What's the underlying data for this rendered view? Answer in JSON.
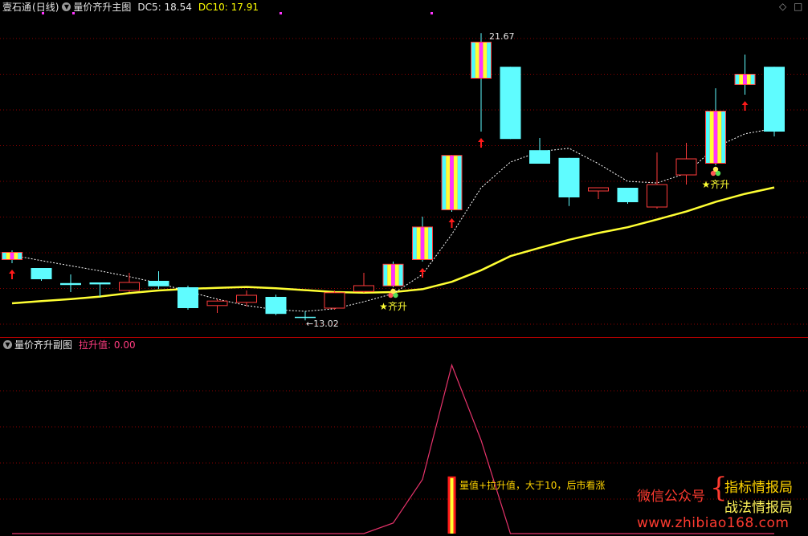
{
  "main_header": {
    "stock": "壹石通",
    "period": "(日线)",
    "title": "量价齐升主图",
    "dc5_label": "DC5: 18.54",
    "dc10_label": "DC10: 17.91"
  },
  "sub_header": {
    "title": "量价齐升副图",
    "value_label": "拉升值: 0.00"
  },
  "corner_icons": [
    "diamond-icon",
    "expand-icon"
  ],
  "colors": {
    "up_candle": "#ff3b3b",
    "down_candle": "#5ffcff",
    "ma_line": "#ffff33",
    "dashed_line": "#ffffff",
    "sub_line": "#e6336b",
    "grid": "#8b0000",
    "arrow": "#ff1a1a"
  },
  "annotations": {
    "high_label": "21.67",
    "low_label": "13.02",
    "qisheng_1": "★齐升",
    "qisheng_2": "★齐升"
  },
  "sub_note": "量值+拉升值，大于10，后市看涨",
  "watermark": {
    "wechat": "微信公众号",
    "name1": "指标情报局",
    "name2": "战法情报局",
    "url": "www.zhibiao168.com"
  },
  "chart_data": [
    {
      "type": "candlestick",
      "title": "量价齐升主图",
      "ylim": [
        12.2,
        22.2
      ],
      "candles": [
        {
          "o": 14.85,
          "c": 14.6,
          "h": 14.9,
          "l": 14.5,
          "color": "rainbow",
          "arrow": true
        },
        {
          "o": 14.35,
          "c": 14.0,
          "h": 14.35,
          "l": 13.95,
          "color": "cyan"
        },
        {
          "o": 13.88,
          "c": 13.82,
          "h": 14.15,
          "l": 13.6,
          "color": "cyan"
        },
        {
          "o": 13.9,
          "c": 13.84,
          "h": 13.9,
          "l": 13.45,
          "color": "cyan"
        },
        {
          "o": 13.65,
          "c": 13.9,
          "h": 14.2,
          "l": 13.6,
          "color": "red"
        },
        {
          "o": 13.95,
          "c": 13.78,
          "h": 14.25,
          "l": 13.7,
          "color": "cyan"
        },
        {
          "o": 13.75,
          "c": 13.1,
          "h": 13.8,
          "l": 13.05,
          "color": "cyan"
        },
        {
          "o": 13.18,
          "c": 13.32,
          "h": 13.38,
          "l": 12.95,
          "color": "red"
        },
        {
          "o": 13.28,
          "c": 13.5,
          "h": 13.65,
          "l": 13.15,
          "color": "red"
        },
        {
          "o": 13.45,
          "c": 12.92,
          "h": 13.52,
          "l": 12.88,
          "color": "cyan"
        },
        {
          "o": 12.83,
          "c": 12.8,
          "h": 13.0,
          "l": 12.72,
          "color": "cyan"
        },
        {
          "o": 13.1,
          "c": 13.58,
          "h": 13.65,
          "l": 13.05,
          "color": "red"
        },
        {
          "o": 13.62,
          "c": 13.8,
          "h": 14.2,
          "l": 13.58,
          "color": "red"
        },
        {
          "o": 13.78,
          "c": 14.48,
          "h": 14.55,
          "l": 13.75,
          "color": "rainbow",
          "mark": "qisheng_1"
        },
        {
          "o": 14.6,
          "c": 15.64,
          "h": 15.95,
          "l": 14.55,
          "color": "rainbow",
          "arrow": true
        },
        {
          "o": 16.15,
          "c": 17.87,
          "h": 17.87,
          "l": 16.1,
          "color": "rainbow",
          "arrow": true
        },
        {
          "o": 20.25,
          "c": 21.4,
          "h": 21.67,
          "l": 18.6,
          "color": "rainbow",
          "arrow": true,
          "label": "high_label"
        },
        {
          "o": 20.62,
          "c": 18.37,
          "h": 20.62,
          "l": 18.37,
          "color": "cyan"
        },
        {
          "o": 18.02,
          "c": 17.6,
          "h": 18.4,
          "l": 17.6,
          "color": "cyan"
        },
        {
          "o": 17.78,
          "c": 16.55,
          "h": 17.78,
          "l": 16.28,
          "color": "cyan"
        },
        {
          "o": 16.75,
          "c": 16.85,
          "h": 16.85,
          "l": 16.5,
          "color": "red"
        },
        {
          "o": 16.85,
          "c": 16.4,
          "h": 16.85,
          "l": 16.35,
          "color": "cyan"
        },
        {
          "o": 16.25,
          "c": 16.95,
          "h": 17.95,
          "l": 16.2,
          "color": "red"
        },
        {
          "o": 17.25,
          "c": 17.75,
          "h": 18.25,
          "l": 16.95,
          "color": "red"
        },
        {
          "o": 17.6,
          "c": 19.25,
          "h": 19.95,
          "l": 17.55,
          "color": "rainbow",
          "mark": "qisheng_2"
        },
        {
          "o": 20.4,
          "c": 20.05,
          "h": 21.0,
          "l": 19.75,
          "color": "rainbow",
          "arrow": true
        },
        {
          "o": 20.62,
          "c": 18.6,
          "h": 20.62,
          "l": 18.45,
          "color": "cyan"
        }
      ],
      "ma_line": [
        13.25,
        13.32,
        13.38,
        13.46,
        13.57,
        13.65,
        13.7,
        13.73,
        13.76,
        13.72,
        13.66,
        13.6,
        13.58,
        13.6,
        13.69,
        13.92,
        14.28,
        14.72,
        14.98,
        15.23,
        15.44,
        15.62,
        15.86,
        16.11,
        16.41,
        16.66,
        16.86
      ],
      "dashed_line": [
        14.75,
        14.58,
        14.42,
        14.26,
        14.08,
        13.88,
        13.62,
        13.38,
        13.18,
        13.05,
        13.0,
        13.08,
        13.3,
        13.55,
        14.15,
        15.4,
        16.85,
        17.65,
        17.98,
        18.08,
        17.6,
        17.05,
        17.0,
        17.3,
        18.12,
        18.53,
        18.7
      ],
      "dashed_start": [
        14.85,
        14.6
      ]
    },
    {
      "type": "line",
      "title": "量价齐升副图",
      "ylim": [
        0,
        60
      ],
      "values": [
        0,
        0,
        0,
        0,
        0,
        0,
        0,
        0,
        0,
        0,
        0,
        0,
        0,
        3.5,
        18,
        56,
        31,
        0,
        0,
        0,
        0,
        0,
        0,
        0,
        0,
        0,
        0
      ],
      "bar": {
        "index": 15,
        "value": 19
      }
    }
  ]
}
